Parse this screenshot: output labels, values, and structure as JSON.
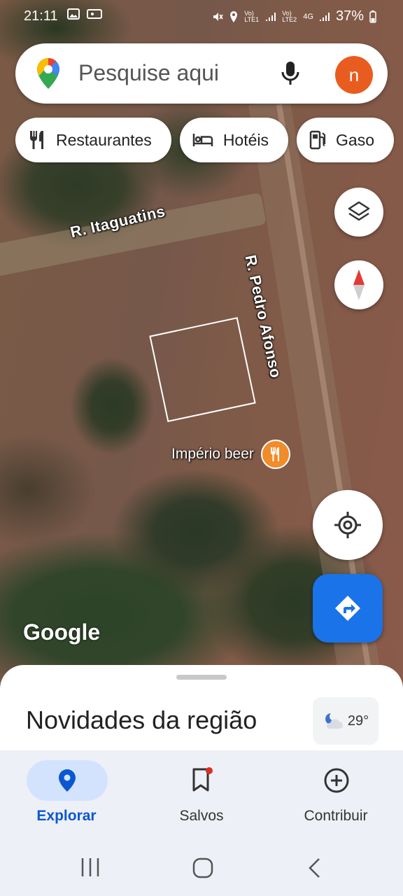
{
  "status": {
    "time": "21:11",
    "sim1": "Vo) LTE1",
    "sim2": "Vo) LTE2",
    "network": "4G",
    "battery": "37%"
  },
  "search": {
    "placeholder": "Pesquise aqui",
    "avatar_letter": "n"
  },
  "chips": [
    {
      "label": "Restaurantes",
      "icon": "restaurant-icon"
    },
    {
      "label": "Hotéis",
      "icon": "hotel-icon"
    },
    {
      "label": "Gaso",
      "icon": "gas-station-icon"
    }
  ],
  "map": {
    "streets": [
      "R. Itaguatins",
      "R. Pedro Afonso"
    ],
    "poi": {
      "label": "Império beer",
      "icon": "restaurant-icon"
    },
    "attribution": "Google"
  },
  "sheet": {
    "title": "Novidades da região",
    "temperature": "29°"
  },
  "nav": {
    "items": [
      {
        "label": "Explorar",
        "icon": "explore-pin-icon",
        "active": true
      },
      {
        "label": "Salvos",
        "icon": "bookmark-icon",
        "active": false
      },
      {
        "label": "Contribuir",
        "icon": "add-circle-icon",
        "active": false
      }
    ]
  },
  "colors": {
    "accent": "#1a73e8",
    "avatar": "#e85d1f",
    "poi": "#f08c2a"
  }
}
